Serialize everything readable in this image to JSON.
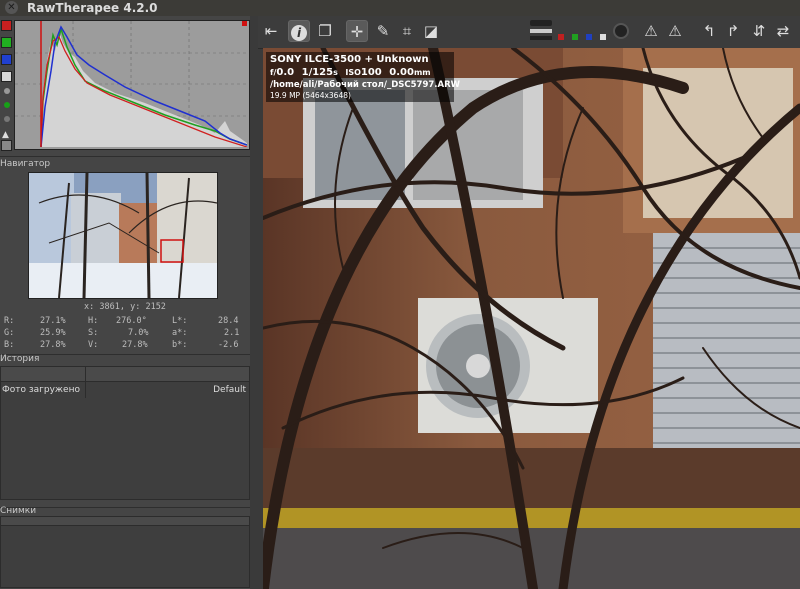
{
  "window": {
    "title": "RawTherapee 4.2.0"
  },
  "navigator": {
    "label": "Навигатор",
    "coords": "x: 3861, y: 2152",
    "r_label": "R:",
    "r_value": "27.1%",
    "g_label": "G:",
    "g_value": "25.9%",
    "b_label": "B:",
    "b_value": "27.8%",
    "h_label": "H:",
    "h_value": "276.0°",
    "s_label": "S:",
    "s_value": "7.0%",
    "v_label": "V:",
    "v_value": "27.8%",
    "l_label": "L*:",
    "l_value": "28.4",
    "a_label": "a*:",
    "a_value": "2.1",
    "bb_label": "b*:",
    "bb_value": "-2.6"
  },
  "history": {
    "label": "История",
    "entries": [
      {
        "name": "Фото загружено",
        "value": "Default"
      }
    ]
  },
  "snapshots": {
    "label": "Снимки"
  },
  "exif": {
    "camera": "SONY ILCE-3500 + Unknown",
    "aperture_prefix": "f/",
    "aperture": "0.0",
    "shutter": "1/125",
    "shutter_unit": "s",
    "iso_label": "ISO",
    "iso": "100",
    "focal": "0.00",
    "focal_unit": "mm",
    "path": "/home/ali/Рабочий стол/_DSC5797.ARW",
    "megapixels": "19.9 MP (5464x3648)"
  },
  "toolbar": {
    "icons": [
      "collapse-left-icon",
      "info-icon",
      "before-after-icon",
      "hand-icon",
      "color-picker-icon",
      "crop-icon",
      "straighten-icon",
      "preview-mode-icon",
      "focus-mask-icon",
      "clip-highlight-icon",
      "clip-shadow-icon",
      "rotate-left-icon",
      "rotate-right-icon",
      "flip-vertical-icon",
      "flip-horizontal-icon"
    ]
  },
  "colors": {
    "accent_red": "#d01010",
    "panel_bg": "#454545",
    "dark_bg": "#3a3a3a"
  }
}
